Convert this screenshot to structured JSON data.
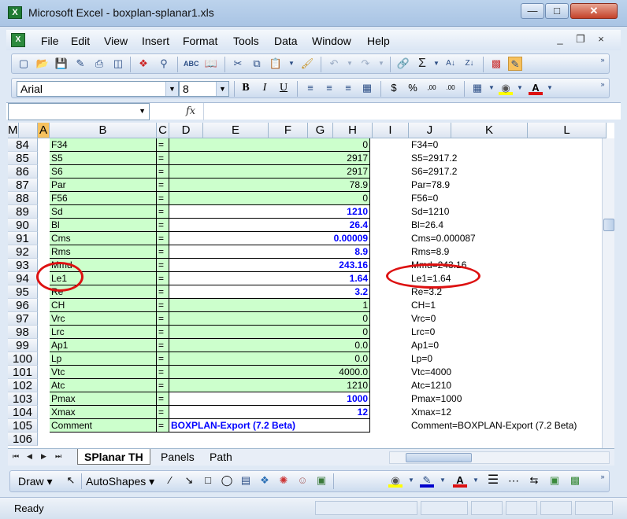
{
  "window": {
    "title": "Microsoft Excel - boxplan-splanar1.xls",
    "min_label": "—",
    "max_label": "□",
    "close_label": "✕"
  },
  "menu": [
    "File",
    "Edit",
    "View",
    "Insert",
    "Format",
    "Tools",
    "Data",
    "Window",
    "Help"
  ],
  "doc_controls": [
    "_",
    "×"
  ],
  "format_toolbar": {
    "font": "Arial",
    "size": "8",
    "bold": "B",
    "italic": "I",
    "underline": "U"
  },
  "formula_bar": {
    "fx": "fx"
  },
  "columns": [
    "A",
    "B",
    "C",
    "D",
    "E",
    "F",
    "G",
    "H",
    "I",
    "J",
    "K",
    "L",
    "M"
  ],
  "rows": [
    {
      "num": "84",
      "name": "F34",
      "eq": "=",
      "value": "0",
      "style": "green",
      "export": "F34=0"
    },
    {
      "num": "85",
      "name": "S5",
      "eq": "=",
      "value": "2917",
      "style": "green",
      "export": "S5=2917.2"
    },
    {
      "num": "86",
      "name": "S6",
      "eq": "=",
      "value": "2917",
      "style": "green",
      "export": "S6=2917.2"
    },
    {
      "num": "87",
      "name": "Par",
      "eq": "=",
      "value": "78.9",
      "style": "green",
      "export": "Par=78.9"
    },
    {
      "num": "88",
      "name": "F56",
      "eq": "=",
      "value": "0",
      "style": "green",
      "export": "F56=0"
    },
    {
      "num": "89",
      "name": "Sd",
      "eq": "=",
      "value": "1210",
      "style": "input",
      "export": "Sd=1210"
    },
    {
      "num": "90",
      "name": "Bl",
      "eq": "=",
      "value": "26.4",
      "style": "input",
      "export": "Bl=26.4"
    },
    {
      "num": "91",
      "name": "Cms",
      "eq": "=",
      "value": "0.00009",
      "style": "input",
      "export": "Cms=0.000087"
    },
    {
      "num": "92",
      "name": "Rms",
      "eq": "=",
      "value": "8.9",
      "style": "input",
      "export": "Rms=8.9"
    },
    {
      "num": "93",
      "name": "Mmd",
      "eq": "=",
      "value": "243.16",
      "style": "input",
      "export": "Mmd=243.16"
    },
    {
      "num": "94",
      "name": "Le1",
      "eq": "=",
      "value": "1.64",
      "style": "input",
      "export": "Le1=1.64"
    },
    {
      "num": "95",
      "name": "Re",
      "eq": "=",
      "value": "3.2",
      "style": "input",
      "export": "Re=3.2"
    },
    {
      "num": "96",
      "name": "CH",
      "eq": "=",
      "value": "1",
      "style": "green",
      "export": "CH=1"
    },
    {
      "num": "97",
      "name": "Vrc",
      "eq": "=",
      "value": "0",
      "style": "green",
      "export": "Vrc=0"
    },
    {
      "num": "98",
      "name": "Lrc",
      "eq": "=",
      "value": "0",
      "style": "green",
      "export": "Lrc=0"
    },
    {
      "num": "99",
      "name": "Ap1",
      "eq": "=",
      "value": "0.0",
      "style": "green",
      "export": "Ap1=0"
    },
    {
      "num": "100",
      "name": "Lp",
      "eq": "=",
      "value": "0.0",
      "style": "green",
      "export": "Lp=0"
    },
    {
      "num": "101",
      "name": "Vtc",
      "eq": "=",
      "value": "4000.0",
      "style": "green",
      "export": "Vtc=4000"
    },
    {
      "num": "102",
      "name": "Atc",
      "eq": "=",
      "value": "1210",
      "style": "green",
      "export": "Atc=1210"
    },
    {
      "num": "103",
      "name": "Pmax",
      "eq": "=",
      "value": "1000",
      "style": "input",
      "export": "Pmax=1000"
    },
    {
      "num": "104",
      "name": "Xmax",
      "eq": "=",
      "value": "12",
      "style": "input",
      "export": "Xmax=12"
    },
    {
      "num": "105",
      "name": "Comment",
      "eq": "=",
      "value": "BOXPLAN-Export (7.2 Beta)",
      "style": "comment",
      "export": "Comment=BOXPLAN-Export (7.2 Beta)"
    },
    {
      "num": "106",
      "name": "",
      "eq": "",
      "value": "",
      "style": "empty",
      "export": ""
    }
  ],
  "sheet_tabs": [
    "SPlanar TH",
    "Panels",
    "Path"
  ],
  "draw_toolbar": {
    "draw": "Draw",
    "autoshapes": "AutoShapes"
  },
  "status": {
    "text": "Ready"
  },
  "colors": {
    "green_cell": "#ccffcc",
    "input_text": "#0000ff",
    "highlight": "#dd1111"
  }
}
